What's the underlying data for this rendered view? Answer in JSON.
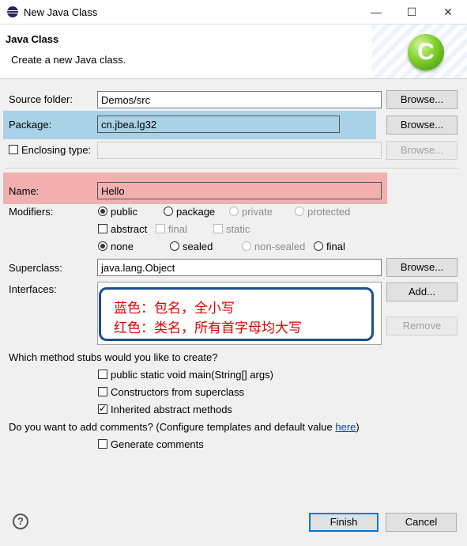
{
  "window": {
    "title": "New Java Class",
    "minimize": "—",
    "maximize": "☐",
    "close": "✕"
  },
  "banner": {
    "heading": "Java Class",
    "description": "Create a new Java class."
  },
  "form": {
    "source_folder": {
      "label": "Source folder:",
      "value": "Demos/src",
      "browse": "Browse..."
    },
    "package": {
      "label": "Package:",
      "value": "cn.jbea.lg32",
      "browse": "Browse..."
    },
    "enclosing_type": {
      "label": "Enclosing type:",
      "value": "",
      "browse": "Browse..."
    },
    "name": {
      "label": "Name:",
      "value": "Hello"
    },
    "modifiers": {
      "label": "Modifiers:",
      "access": [
        "public",
        "package",
        "private",
        "protected"
      ],
      "abstract": "abstract",
      "final": "final",
      "static": "static",
      "sealing": [
        "none",
        "sealed",
        "non-sealed",
        "final"
      ]
    },
    "superclass": {
      "label": "Superclass:",
      "value": "java.lang.Object",
      "browse": "Browse..."
    },
    "interfaces": {
      "label": "Interfaces:",
      "add": "Add...",
      "remove": "Remove"
    }
  },
  "annotation": {
    "line1": "蓝色：包名，全小写",
    "line2": "红色：类名，所有首字母均大写"
  },
  "stubs": {
    "question": "Which method stubs would you like to create?",
    "main": "public static void main(String[] args)",
    "constructors": "Constructors from superclass",
    "inherited": "Inherited abstract methods"
  },
  "comments": {
    "question_prefix": "Do you want to add comments? (Configure templates and default value ",
    "link": "here",
    "question_suffix": ")",
    "generate": "Generate comments"
  },
  "footer": {
    "help": "?",
    "finish": "Finish",
    "cancel": "Cancel"
  },
  "colors": {
    "package_highlight": "#a9d2e6",
    "name_highlight": "#f2b0b0",
    "annotation_border": "#1f4e8c",
    "annotation_text": "#e00000"
  }
}
